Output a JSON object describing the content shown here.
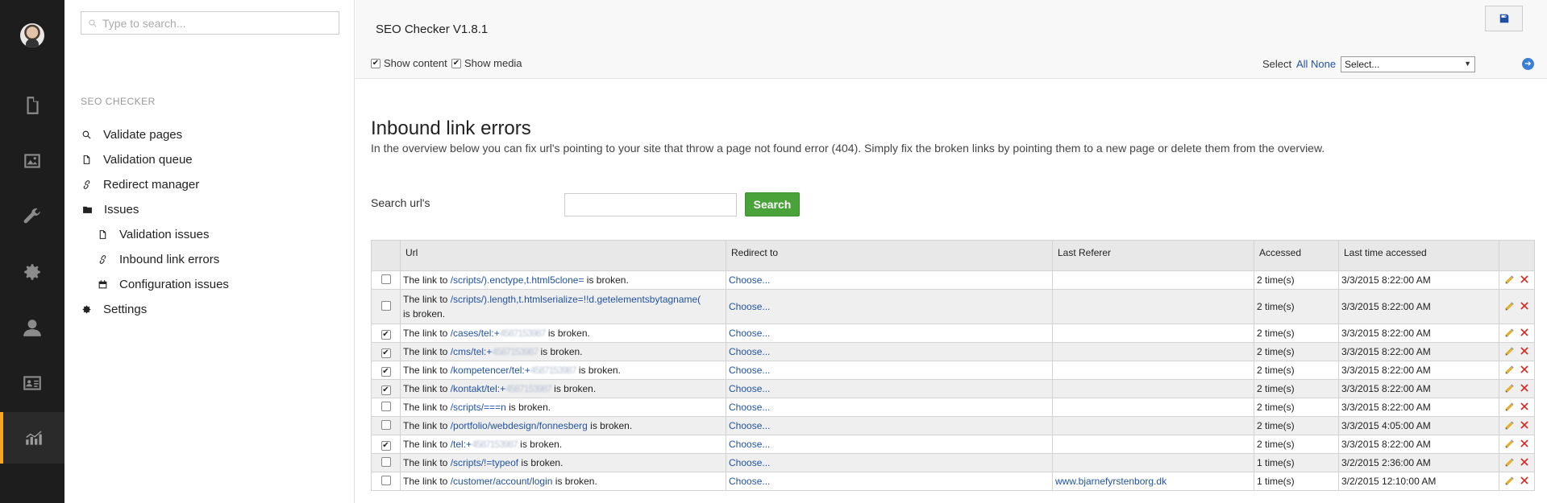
{
  "search": {
    "placeholder": "Type to search..."
  },
  "tree": {
    "section_title": "SEO CHECKER",
    "items": [
      {
        "label": "Validate pages",
        "icon": "search-icon"
      },
      {
        "label": "Validation queue",
        "icon": "document-icon"
      },
      {
        "label": "Redirect manager",
        "icon": "link-icon"
      },
      {
        "label": "Issues",
        "icon": "folder-icon"
      },
      {
        "label": "Validation issues",
        "icon": "document-icon"
      },
      {
        "label": "Inbound link errors",
        "icon": "link-icon"
      },
      {
        "label": "Configuration issues",
        "icon": "calendar-icon"
      },
      {
        "label": "Settings",
        "icon": "gear-icon"
      }
    ]
  },
  "header": {
    "title": "SEO Checker V1.8.1",
    "show_content": "Show content",
    "show_media": "Show media",
    "select_label": "Select",
    "select_all": "All",
    "select_none": "None",
    "dropdown_value": "Select..."
  },
  "main": {
    "title": "Inbound link errors",
    "intro": "In the overview below you can fix url's pointing to your site that throw a page not found error (404). Simply fix the broken links by pointing them to a new page or delete them from the overview.",
    "search_label": "Search url's",
    "search_button": "Search"
  },
  "table": {
    "columns": [
      "Url",
      "Redirect to",
      "Last Referer",
      "Accessed",
      "Last time accessed"
    ],
    "rows": [
      {
        "checked": false,
        "prefix": "The link to ",
        "url": "/scripts/).enctype,t.html5clone=",
        "blur": "",
        "suffix": " is broken.",
        "redirect": "Choose...",
        "referer": "",
        "accessed": "2 time(s)",
        "last": "3/3/2015 8:22:00 AM"
      },
      {
        "checked": false,
        "prefix": "The link to ",
        "url": "/scripts/).length,t.htmlserialize=!!d.getelementsbytagname(",
        "blur": "",
        "suffix": " is broken.",
        "redirect": "Choose...",
        "referer": "",
        "accessed": "2 time(s)",
        "last": "3/3/2015 8:22:00 AM"
      },
      {
        "checked": true,
        "prefix": "The link to ",
        "url": "/cases/tel:+",
        "blur": "4587153987",
        "suffix": " is broken.",
        "redirect": "Choose...",
        "referer": "",
        "accessed": "2 time(s)",
        "last": "3/3/2015 8:22:00 AM"
      },
      {
        "checked": true,
        "prefix": "The link to ",
        "url": "/cms/tel:+",
        "blur": "4587153987",
        "suffix": " is broken.",
        "redirect": "Choose...",
        "referer": "",
        "accessed": "2 time(s)",
        "last": "3/3/2015 8:22:00 AM"
      },
      {
        "checked": true,
        "prefix": "The link to ",
        "url": "/kompetencer/tel:+",
        "blur": "4587153987",
        "suffix": " is broken.",
        "redirect": "Choose...",
        "referer": "",
        "accessed": "2 time(s)",
        "last": "3/3/2015 8:22:00 AM"
      },
      {
        "checked": true,
        "prefix": "The link to ",
        "url": "/kontakt/tel:+",
        "blur": "4587153987",
        "suffix": " is broken.",
        "redirect": "Choose...",
        "referer": "",
        "accessed": "2 time(s)",
        "last": "3/3/2015 8:22:00 AM"
      },
      {
        "checked": false,
        "prefix": "The link to ",
        "url": "/scripts/===n",
        "blur": "",
        "suffix": " is broken.",
        "redirect": "Choose...",
        "referer": "",
        "accessed": "2 time(s)",
        "last": "3/3/2015 8:22:00 AM"
      },
      {
        "checked": false,
        "prefix": "The link to ",
        "url": "/portfolio/webdesign/fonnesberg",
        "blur": "",
        "suffix": " is broken.",
        "redirect": "Choose...",
        "referer": "",
        "accessed": "2 time(s)",
        "last": "3/3/2015 4:05:00 AM"
      },
      {
        "checked": true,
        "prefix": "The link to ",
        "url": "/tel:+",
        "blur": "4587153987",
        "suffix": " is broken.",
        "redirect": "Choose...",
        "referer": "",
        "accessed": "2 time(s)",
        "last": "3/3/2015 8:22:00 AM"
      },
      {
        "checked": false,
        "prefix": "The link to ",
        "url": "/scripts/!=typeof",
        "blur": "",
        "suffix": " is broken.",
        "redirect": "Choose...",
        "referer": "",
        "accessed": "1 time(s)",
        "last": "3/2/2015 2:36:00 AM"
      },
      {
        "checked": false,
        "prefix": "The link to ",
        "url": "/customer/account/login",
        "blur": "",
        "suffix": " is broken.",
        "redirect": "Choose...",
        "referer": "www.bjarnefyrstenborg.dk",
        "accessed": "1 time(s)",
        "last": "3/2/2015 12:10:00 AM"
      }
    ]
  },
  "colors": {
    "accent": "#f5a623",
    "link": "#2152a3",
    "search_button": "#4aa33a",
    "delete": "#d9231f"
  }
}
